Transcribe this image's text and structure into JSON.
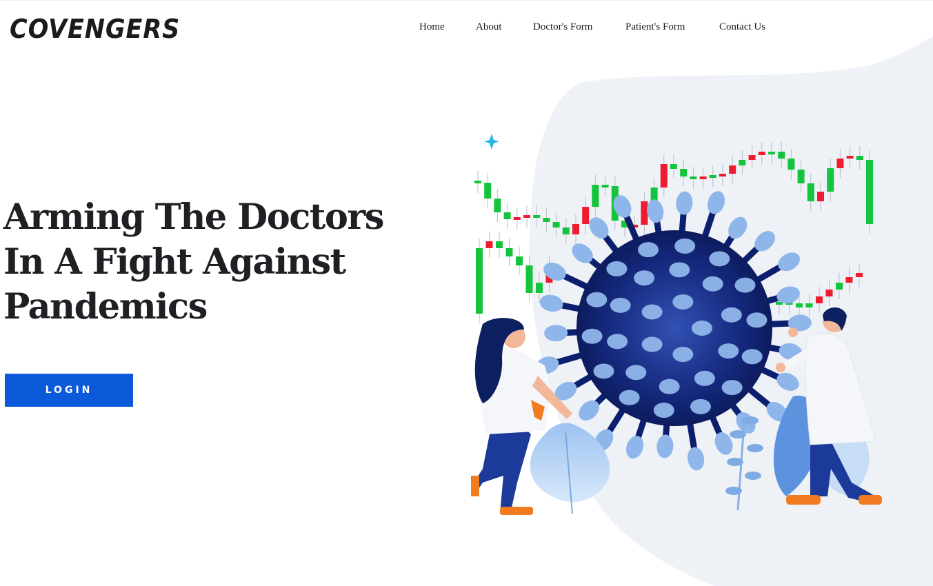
{
  "brand": {
    "name": "COVENGERS"
  },
  "nav": {
    "items": [
      {
        "label": "Home"
      },
      {
        "label": "About"
      },
      {
        "label": "Doctor's Form"
      },
      {
        "label": "Patient's Form"
      },
      {
        "label": "Contact Us"
      }
    ]
  },
  "hero": {
    "title_lines": [
      "Arming The Doctors",
      "In A Fight Against",
      "Pandemics"
    ],
    "login_label": "LOGIN"
  },
  "colors": {
    "accent": "#0b5ad9",
    "blob": "#eef2f6",
    "candle_up": "#14c43c",
    "candle_down": "#ee1c2e",
    "virus_dark": "#0c1f6e",
    "virus_spot": "#8fb6ea"
  },
  "icons": {
    "sparkle": "sparkle-icon"
  }
}
